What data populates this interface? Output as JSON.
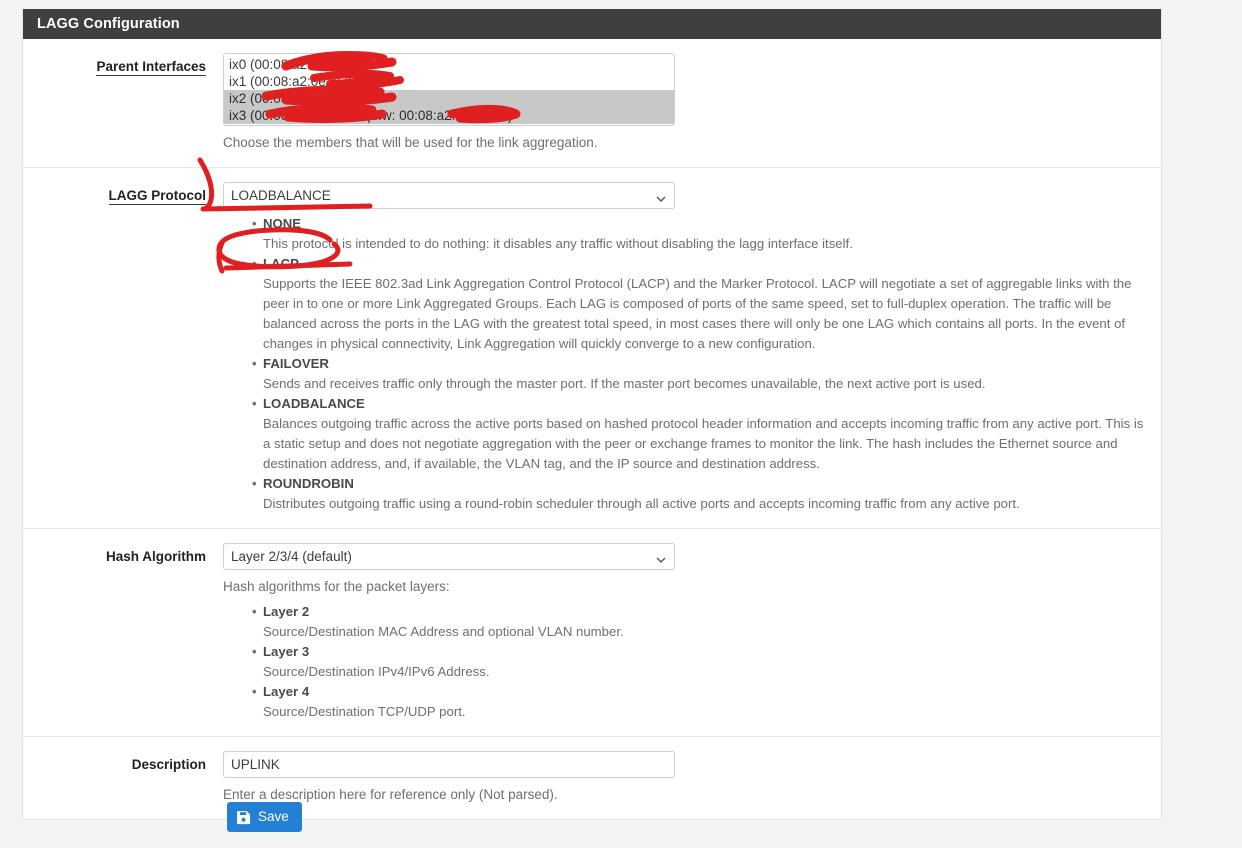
{
  "panel": {
    "title": "LAGG Configuration"
  },
  "fields": {
    "parent_interfaces": {
      "label": "Parent Interfaces",
      "options": [
        {
          "text": "ix0 (00:08:a2:0e:a0:59)",
          "selected": false,
          "redacted": true
        },
        {
          "text": "ix1 (00:08:a2:0e:a5:5a)",
          "selected": false,
          "redacted": true
        },
        {
          "text": "ix2 (00:08:a2:0e:a6:ab)",
          "selected": true,
          "redacted": true
        },
        {
          "text": "ix3 (00:08:a2:0e:a6:ab | hw: 00:08:a2:0e:a5:5b)",
          "selected": true,
          "redacted": true
        }
      ],
      "help": "Choose the members that will be used for the link aggregation."
    },
    "lagg_protocol": {
      "label": "LAGG Protocol",
      "value": "LOADBALANCE",
      "options": [
        "NONE",
        "LACP",
        "FAILOVER",
        "LOADBALANCE",
        "ROUNDROBIN"
      ],
      "descriptions": [
        {
          "term": "NONE",
          "body": "This protocol is intended to do nothing: it disables any traffic without disabling the lagg interface itself."
        },
        {
          "term": "LACP",
          "body": "Supports the IEEE 802.3ad Link Aggregation Control Protocol (LACP) and the Marker Protocol. LACP will negotiate a set of aggregable links with the peer in to one or more Link Aggregated Groups. Each LAG is composed of ports of the same speed, set to full-duplex operation. The traffic will be balanced across the ports in the LAG with the greatest total speed, in most cases there will only be one LAG which contains all ports. In the event of changes in physical connectivity, Link Aggregation will quickly converge to a new configuration."
        },
        {
          "term": "FAILOVER",
          "body": "Sends and receives traffic only through the master port. If the master port becomes unavailable, the next active port is used."
        },
        {
          "term": "LOADBALANCE",
          "body": "Balances outgoing traffic across the active ports based on hashed protocol header information and accepts incoming traffic from any active port. This is a static setup and does not negotiate aggregation with the peer or exchange frames to monitor the link. The hash includes the Ethernet source and destination address, and, if available, the VLAN tag, and the IP source and destination address."
        },
        {
          "term": "ROUNDROBIN",
          "body": "Distributes outgoing traffic using a round-robin scheduler through all active ports and accepts incoming traffic from any active port."
        }
      ]
    },
    "hash_algorithm": {
      "label": "Hash Algorithm",
      "value": "Layer 2/3/4 (default)",
      "intro": "Hash algorithms for the packet layers:",
      "descriptions": [
        {
          "term": "Layer 2",
          "body": "Source/Destination MAC Address and optional VLAN number."
        },
        {
          "term": "Layer 3",
          "body": "Source/Destination IPv4/IPv6 Address."
        },
        {
          "term": "Layer 4",
          "body": "Source/Destination TCP/UDP port."
        }
      ]
    },
    "description": {
      "label": "Description",
      "value": "UPLINK",
      "placeholder": "",
      "help": "Enter a description here for reference only (Not parsed)."
    }
  },
  "actions": {
    "save_label": "Save",
    "save_icon": "save-floppy-icon"
  },
  "annotations": {
    "color": "#e02020",
    "marks": [
      {
        "name": "arrow-to-none-option",
        "kind": "hook-stroke"
      },
      {
        "name": "circle-around-lacp",
        "kind": "ellipse"
      },
      {
        "name": "redaction-scribbles",
        "kind": "scribble"
      }
    ]
  },
  "colors": {
    "panel_header_bg": "#3f3f3f",
    "accent_button": "#2380d4",
    "page_bg": "#f4f4f4",
    "annotation_red": "#e02020",
    "selection_gray": "#c8c8c8"
  }
}
